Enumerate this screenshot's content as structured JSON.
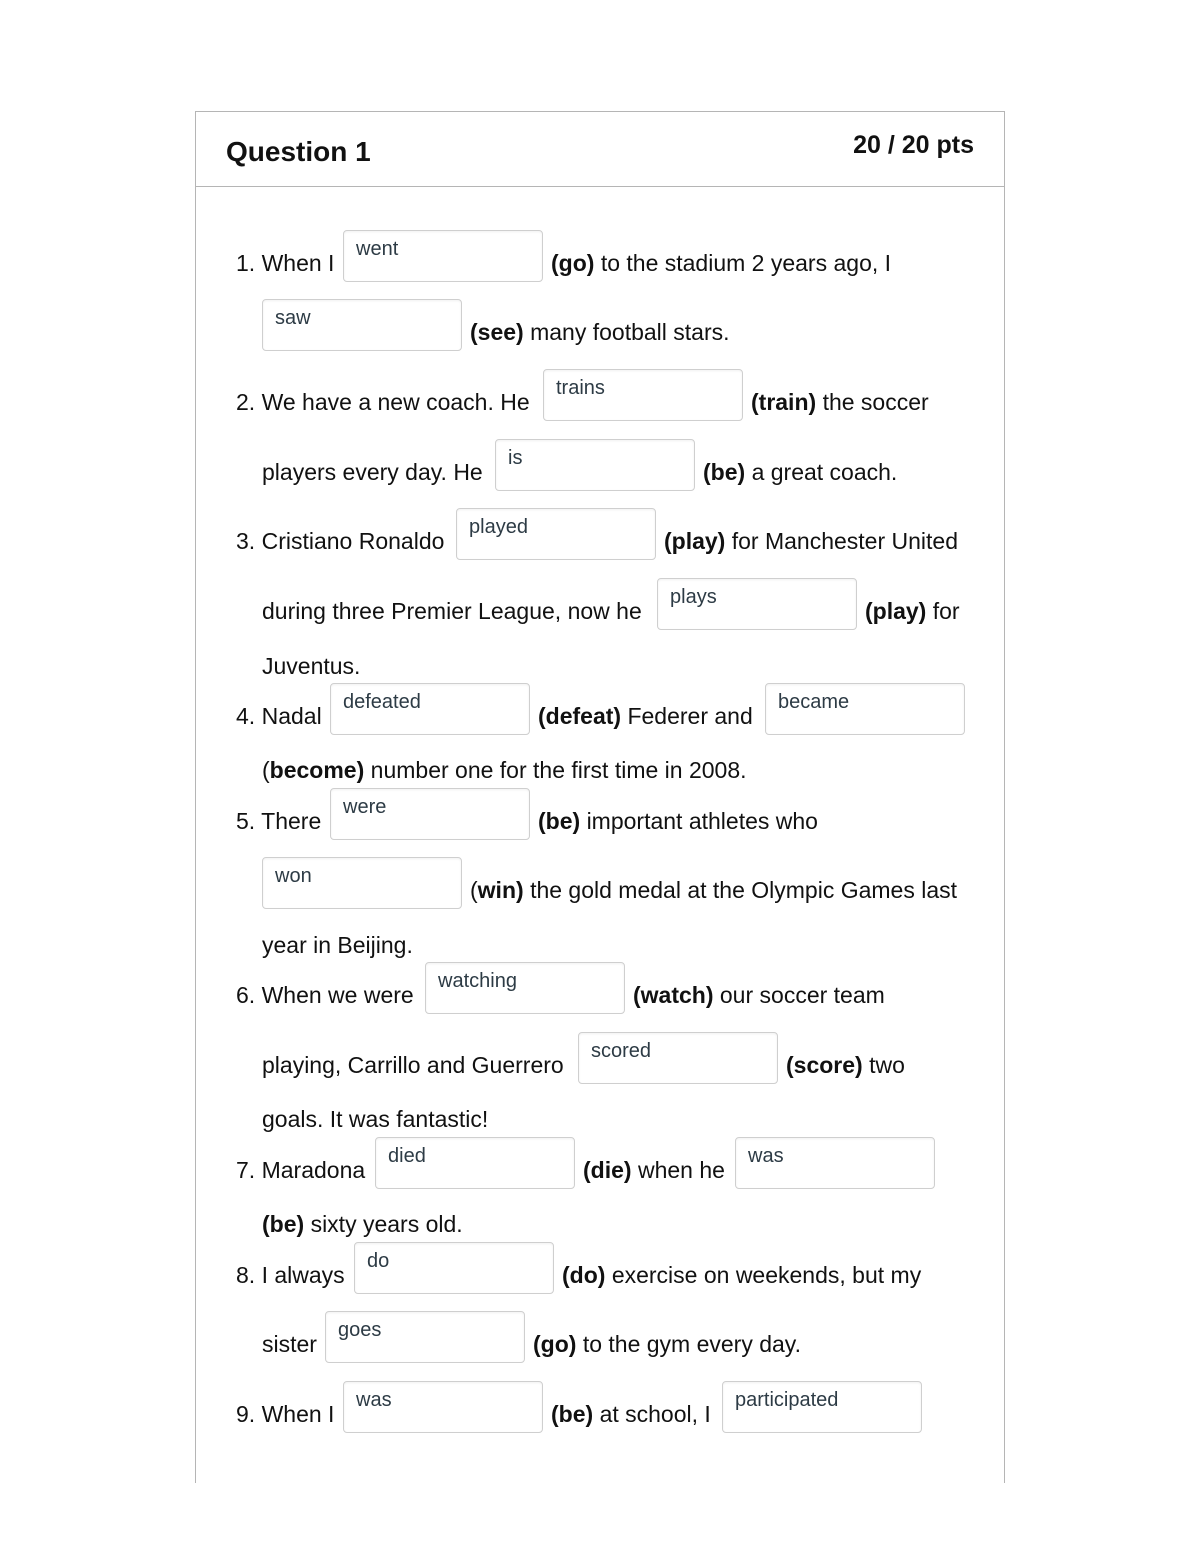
{
  "question": {
    "title": "Question 1",
    "points": "20 / 20 pts"
  },
  "items": [
    {
      "number": "1.",
      "t1": "When I",
      "a1": "went",
      "v1": "(go)",
      "t2": "to the stadium 2 years ago, I",
      "a2": "saw",
      "v2": "(see)",
      "t3": "many football stars."
    },
    {
      "number": "2.",
      "t1": "We have a new coach. He",
      "a1": "trains",
      "v1": "(train)",
      "t2": "the soccer",
      "t3": "players every day. He",
      "a2": "is",
      "v2": "(be)",
      "t4": "a great coach."
    },
    {
      "number": "3.",
      "t1": "Cristiano Ronaldo",
      "a1": "played",
      "v1": "(play)",
      "t2": "for Manchester United",
      "t3": "during three Premier League, now he",
      "a2": "plays",
      "v2": "(play)",
      "t4": "for",
      "t5": "Juventus."
    },
    {
      "number": "4.",
      "t1": "Nadal",
      "a1": "defeated",
      "v1": "(defeat)",
      "t2": "Federer and",
      "a2": "became",
      "p2": "(",
      "v2": "become)",
      "t3": "number one for the first time in 2008."
    },
    {
      "number": "5.",
      "t1": "There",
      "a1": "were",
      "v1": "(be)",
      "t2": "important athletes who",
      "a2": "won",
      "p2": "(",
      "v2": "win)",
      "t3": "the gold medal at the Olympic Games last",
      "t4": "year in Beijing."
    },
    {
      "number": "6.",
      "t1": "When we were",
      "a1": "watching",
      "v1": "(watch)",
      "t2": "our soccer team",
      "t3": "playing, Carrillo and Guerrero",
      "a2": "scored",
      "v2": "(score)",
      "t4": "two",
      "t5": "goals. It was fantastic!"
    },
    {
      "number": "7.",
      "t1": "Maradona",
      "a1": "died",
      "v1": "(die)",
      "t2": "when he",
      "a2": "was",
      "v2": "(be)",
      "t3": "sixty years old."
    },
    {
      "number": "8.",
      "t1": "I always",
      "a1": "do",
      "v1": "(do)",
      "t2": "exercise on weekends, but my",
      "t3": "sister",
      "a2": "goes",
      "v2": "(go)",
      "t4": "to the gym every day."
    },
    {
      "number": "9.",
      "t1": "When I",
      "a1": "was",
      "v1": "(be)",
      "t2": "at school, I",
      "a2": "participated"
    }
  ]
}
